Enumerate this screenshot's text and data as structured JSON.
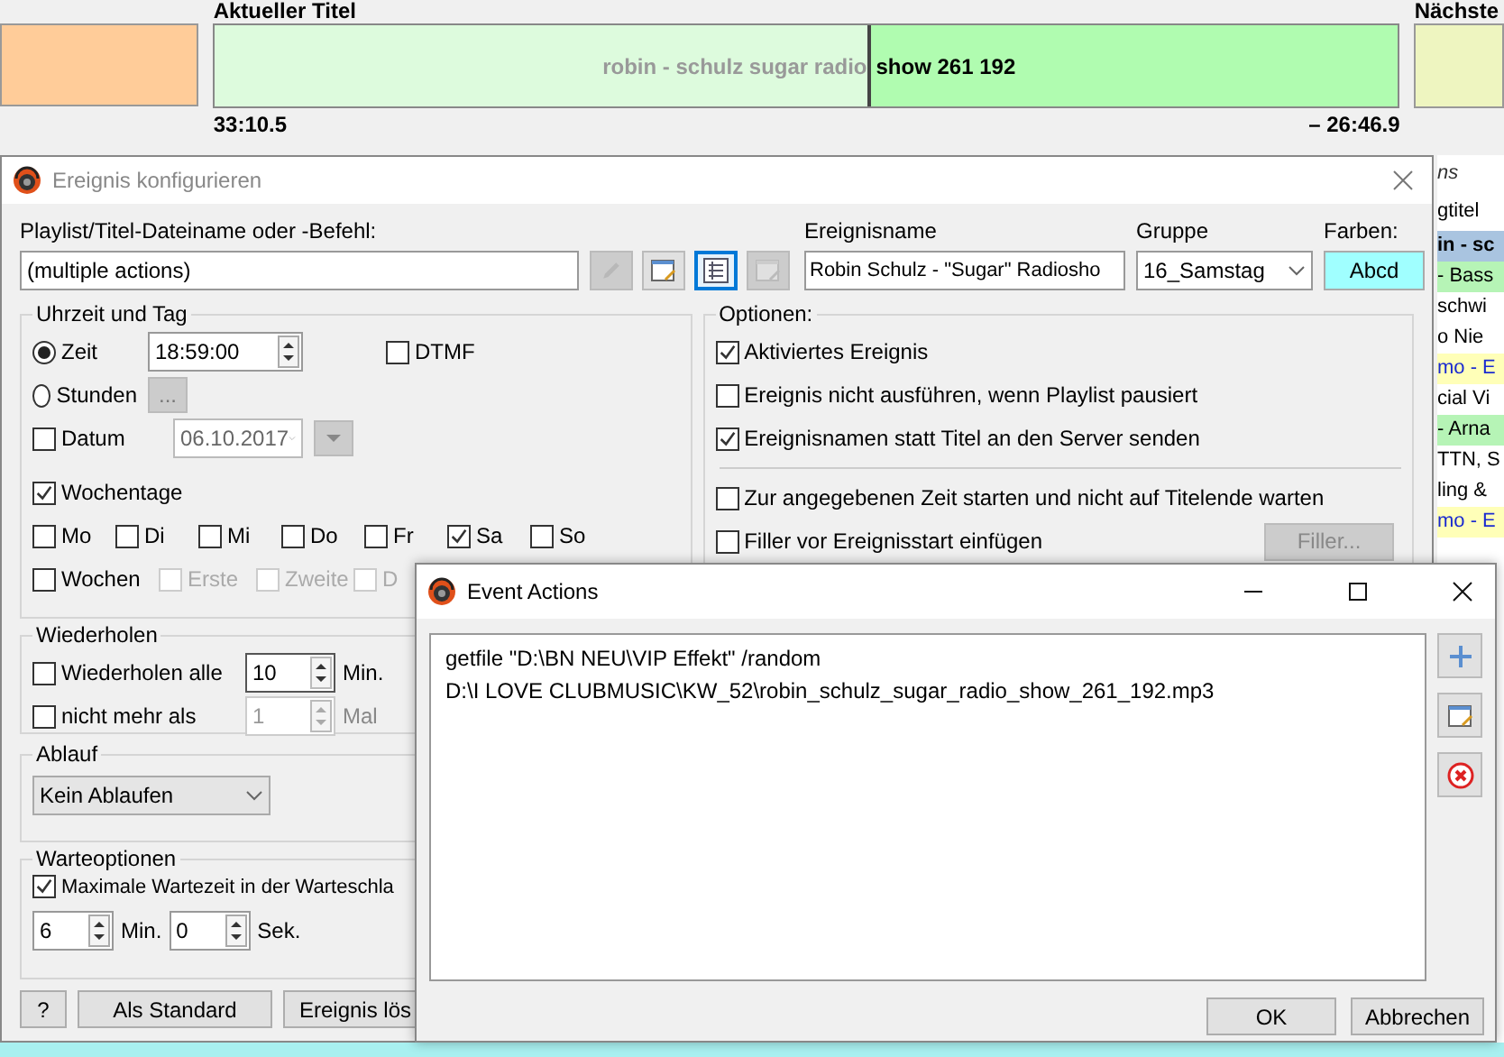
{
  "player": {
    "current_label": "Aktueller Titel",
    "title_played": "robin - schulz sugar radio",
    "title_rest": "show 261 192",
    "level": 0.554,
    "elapsed": "33:10.5",
    "remaining": "– 26:46.9",
    "next_label": "Nächste"
  },
  "background_list": {
    "header_1": "ns",
    "header_2": "gtitel",
    "rows": [
      {
        "text": "in - sc",
        "kind": "current"
      },
      {
        "text": "- Bass",
        "kind": "music"
      },
      {
        "text": "schwi",
        "kind": "plain"
      },
      {
        "text": "o Nie",
        "kind": "plain"
      },
      {
        "text": "mo - E",
        "kind": "jingle"
      },
      {
        "text": "cial Vi",
        "kind": "plain"
      },
      {
        "text": "- Arna",
        "kind": "music"
      },
      {
        "text": "TTN, S",
        "kind": "plain"
      },
      {
        "text": "ling &",
        "kind": "plain"
      },
      {
        "text": "mo - E",
        "kind": "jingle"
      }
    ]
  },
  "dialog": {
    "title": "Ereignis konfigurieren",
    "command_label": "Playlist/Titel-Dateiname oder -Befehl:",
    "command_value": "(multiple actions)",
    "tool_buttons": [
      {
        "kind": "pencil",
        "disabled": true,
        "selected": false
      },
      {
        "kind": "edit",
        "disabled": false,
        "selected": false
      },
      {
        "kind": "list",
        "disabled": false,
        "selected": true
      },
      {
        "kind": "edit",
        "disabled": true,
        "selected": false
      }
    ],
    "name_label": "Ereignisname",
    "name_value": "Robin Schulz - \"Sugar\" Radiosho",
    "group_label": "Gruppe",
    "group_value": "16_Samstag",
    "colors_label": "Farben:",
    "color_sample": "Abcd",
    "time_group": {
      "legend": "Uhrzeit und Tag",
      "modes": [
        {
          "label": "Zeit",
          "selected": true
        },
        {
          "label": "Stunden",
          "selected": false
        }
      ],
      "time": "18:59:00",
      "dtmf": {
        "label": "DTMF",
        "checked": false
      },
      "hours_button": "...",
      "date": {
        "label": "Datum",
        "checked": false,
        "value": "06.10.2017",
        "disabled": true
      },
      "weekdays": {
        "label": "Wochentage",
        "checked": true
      },
      "days": [
        {
          "label": "Mo",
          "checked": false
        },
        {
          "label": "Di",
          "checked": false
        },
        {
          "label": "Mi",
          "checked": false
        },
        {
          "label": "Do",
          "checked": false
        },
        {
          "label": "Fr",
          "checked": false
        },
        {
          "label": "Sa",
          "checked": true
        },
        {
          "label": "So",
          "checked": false
        }
      ],
      "weeks": {
        "label": "Wochen",
        "checked": false
      },
      "week_options": [
        {
          "label": "Erste",
          "checked": false,
          "disabled": true
        },
        {
          "label": "Zweite",
          "checked": false,
          "disabled": true
        },
        {
          "label": "D",
          "checked": false,
          "disabled": true
        }
      ]
    },
    "repeat_group": {
      "legend": "Wiederholen",
      "rows": [
        {
          "label": "Wiederholen alle",
          "checked": false,
          "value": "10",
          "unit": "Min.",
          "disabled": false
        },
        {
          "label": "nicht mehr als",
          "checked": false,
          "value": "1",
          "unit": "Mal",
          "disabled": true
        }
      ]
    },
    "expiry_group": {
      "legend": "Ablauf",
      "value": "Kein Ablaufen"
    },
    "wait_group": {
      "legend": "Warteoptionen",
      "max_wait": {
        "label": "Maximale Wartezeit in der Warteschla",
        "checked": true
      },
      "minutes": "6",
      "minutes_unit": "Min.",
      "seconds": "0",
      "seconds_unit": "Sek."
    },
    "options_group": {
      "legend": "Optionen:",
      "items": [
        {
          "label": "Aktiviertes Ereignis",
          "checked": true
        },
        {
          "label": "Ereignis nicht ausführen, wenn Playlist pausiert",
          "checked": false
        },
        {
          "label": "Ereignisnamen statt Titel an den Server senden",
          "checked": true
        },
        {
          "label": "Zur angegebenen Zeit starten und nicht auf Titelende warten",
          "checked": false
        },
        {
          "label": "Filler vor Ereignisstart einfügen",
          "checked": false
        }
      ],
      "filler_button": "Filler..."
    },
    "buttons": [
      "?",
      "Als Standard",
      "Ereignis lös"
    ]
  },
  "event_actions": {
    "title": "Event Actions",
    "actions": [
      "getfile \"D:\\BN NEU\\VIP Effekt\" /random",
      "D:\\I LOVE CLUBMUSIC\\KW_52\\robin_schulz_sugar_radio_show_261_192.mp3"
    ],
    "buttons": [
      "OK",
      "Abbrechen"
    ]
  }
}
